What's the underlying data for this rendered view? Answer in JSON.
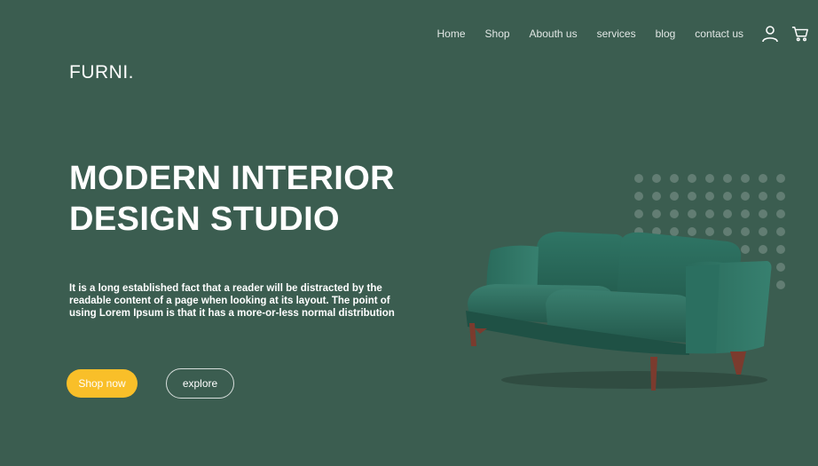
{
  "nav": {
    "links": [
      "Home",
      "Shop",
      "Abouth us",
      "services",
      "blog",
      "contact us"
    ],
    "icons": [
      "user-icon",
      "cart-icon"
    ]
  },
  "brand": {
    "logo": "FURNI."
  },
  "hero": {
    "title_line1": "MODERN INTERIOR",
    "title_line2": "DESIGN STUDIO",
    "description": "It is a long established fact that a reader will be distracted by the readable content of a page when looking at its layout. The point of using Lorem Ipsum is that it has a more-or-less normal distribution",
    "primary_button": "Shop now",
    "secondary_button": "explore"
  },
  "colors": {
    "background": "#3b5d50",
    "accent": "#f9bf29",
    "sofa": "#2c6a5c"
  }
}
